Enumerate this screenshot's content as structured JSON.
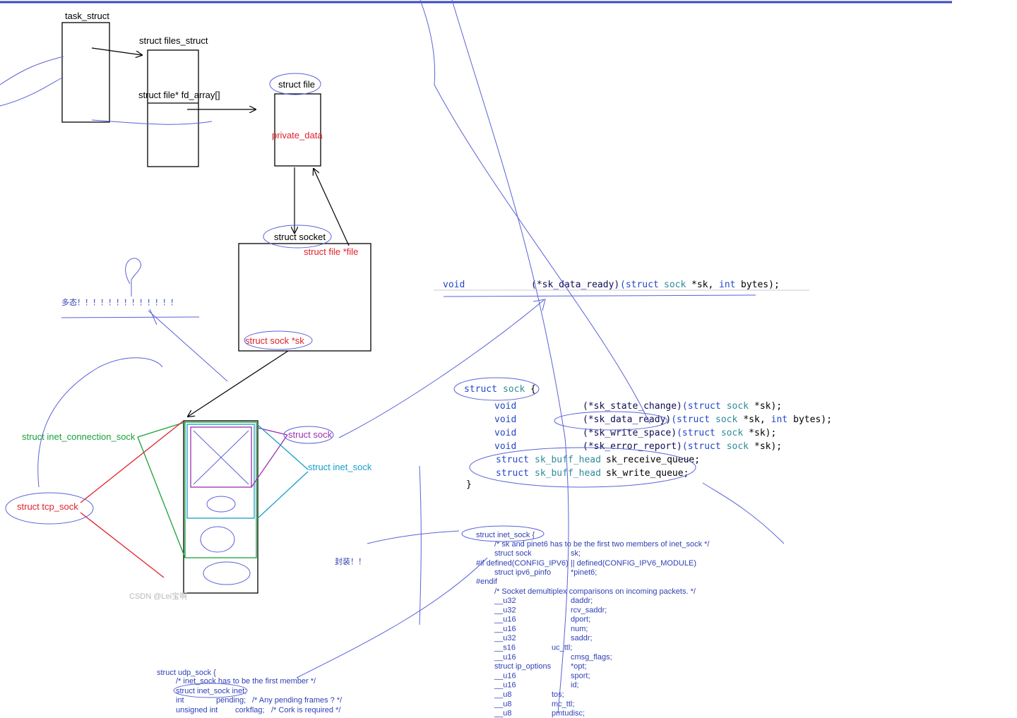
{
  "top_left_diagram": {
    "task_struct": "task_struct",
    "files_struct": "struct files_struct",
    "fd_array": "struct file* fd_array[]",
    "struct_file": "struct file",
    "private_data": "private_data",
    "struct_socket": "struct socket",
    "struct_file_ptr": "struct file *file",
    "struct_sock_ptr": "struct sock *sk",
    "polymorphism_note": "多态！！！！！！！！！！！！！"
  },
  "sock_hierarchy": {
    "inet_connection_sock": "struct inet_connection_sock",
    "struct_sock": "struct sock",
    "inet_sock": "struct inet_sock",
    "tcp_sock": "struct tcp_sock",
    "encapsulation_note": "封装！！"
  },
  "watermark": "CSDN @Lei宝啊",
  "code_single_line": {
    "void": "void",
    "fn": "(*sk_data_ready)",
    "params_struct": "(struct",
    "params_sock": "sock",
    "params_rest": "*sk,",
    "params_int": "int",
    "params_end": "bytes);"
  },
  "code_sock": {
    "header_struct": "struct",
    "header_name": "sock",
    "header_brace": "{",
    "fields": [
      {
        "type": "void",
        "name": "(*sk_state_change)",
        "args_kw": "(struct",
        "args_ty": "sock",
        "args_rest": "*sk);",
        "args_int": "",
        "args_tail": ""
      },
      {
        "type": "void",
        "name": "(*sk_data_ready)",
        "args_kw": "(struct",
        "args_ty": "sock",
        "args_rest": "*sk,",
        "args_int": "int",
        "args_tail": "bytes);"
      },
      {
        "type": "void",
        "name": "(*sk_write_space)",
        "args_kw": "(struct",
        "args_ty": "sock",
        "args_rest": "*sk);",
        "args_int": "",
        "args_tail": ""
      },
      {
        "type": "void",
        "name": "(*sk_error_report)",
        "args_kw": "(struct",
        "args_ty": "sock",
        "args_rest": "*sk);",
        "args_int": "",
        "args_tail": ""
      }
    ],
    "queues": [
      {
        "kw": "struct",
        "ty": "sk_buff_head",
        "name": "sk_receive_queue;"
      },
      {
        "kw": "struct",
        "ty": "sk_buff_head",
        "name": "sk_write_queue;"
      }
    ],
    "closing": "}"
  },
  "inet_sock_code": {
    "lines": [
      "struct inet_sock {",
      "/* sk and pinet6 has to be the first two members of inet_sock */",
      "struct sock",
      "sk;",
      "#if defined(CONFIG_IPV6) || defined(CONFIG_IPV6_MODULE)",
      "struct ipv6_pinfo",
      "*pinet6;",
      "#endif",
      "/* Socket demultiplex comparisons on incoming packets. */"
    ],
    "members": [
      {
        "type": "__u32",
        "name": "daddr;"
      },
      {
        "type": "__u32",
        "name": "rcv_saddr;"
      },
      {
        "type": "__u16",
        "name": "dport;"
      },
      {
        "type": "__u16",
        "name": "num;"
      },
      {
        "type": "__u32",
        "name": "saddr;"
      },
      {
        "type": "__s16",
        "name": "uc_ttl;"
      },
      {
        "type": "__u16",
        "name": "cmsg_flags;"
      },
      {
        "type": "struct ip_options",
        "name": "*opt;"
      },
      {
        "type": "__u16",
        "name": "sport;"
      },
      {
        "type": "__u16",
        "name": "id;"
      },
      {
        "type": "__u8",
        "name": "tos;"
      },
      {
        "type": "__u8",
        "name": "mc_ttl;"
      },
      {
        "type": "__u8",
        "name": "pmtudisc;"
      }
    ]
  },
  "udp_sock_code": {
    "lines": [
      "struct udp_sock {",
      "/* inet_sock has to be the first member */",
      "struct inet_sock inet;",
      "int",
      "pending;",
      "/* Any pending frames ? */",
      "unsigned int",
      "corkflag;",
      "/* Cork is required */"
    ]
  },
  "colors": {
    "red": "#e0202a",
    "green": "#1aa13a",
    "purple": "#9b2fb0",
    "cyan": "#159fcc",
    "pen": "#5a62d8",
    "top_bar": "#3b49c4"
  }
}
